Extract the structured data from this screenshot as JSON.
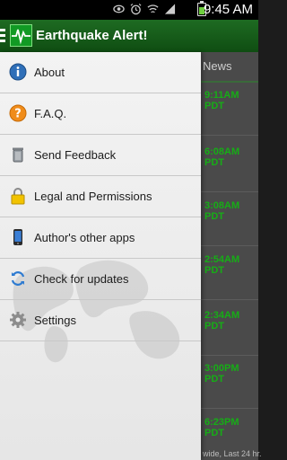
{
  "status_bar": {
    "time": "9:45 AM",
    "icons": [
      "eye-icon",
      "alarm-icon",
      "wifi-icon",
      "signal-icon",
      "battery-icon"
    ]
  },
  "action_bar": {
    "title": "Earthquake Alert!",
    "icon": "seismograph-icon"
  },
  "drawer": {
    "items": [
      {
        "label": "About",
        "icon": "info-icon"
      },
      {
        "label": "F.A.Q.",
        "icon": "question-icon"
      },
      {
        "label": "Send Feedback",
        "icon": "trash-can-icon"
      },
      {
        "label": "Legal and Permissions",
        "icon": "lock-icon"
      },
      {
        "label": "Author's other apps",
        "icon": "phone-icon"
      },
      {
        "label": "Check for updates",
        "icon": "refresh-icon"
      },
      {
        "label": "Settings",
        "icon": "gear-icon"
      }
    ]
  },
  "main": {
    "tab": "News",
    "items": [
      {
        "time": "9:11AM PDT"
      },
      {
        "time": "6:08AM PDT"
      },
      {
        "time": "3:08AM PDT"
      },
      {
        "time": "2:54AM PDT"
      },
      {
        "time": "2:34AM PDT"
      },
      {
        "time": "3:00PM PDT"
      },
      {
        "time": "6:23PM PDT"
      }
    ],
    "footer": "wide, Last 24 hr."
  },
  "colors": {
    "action_bar": "#1e6b22",
    "accent_time": "#16ad16"
  }
}
